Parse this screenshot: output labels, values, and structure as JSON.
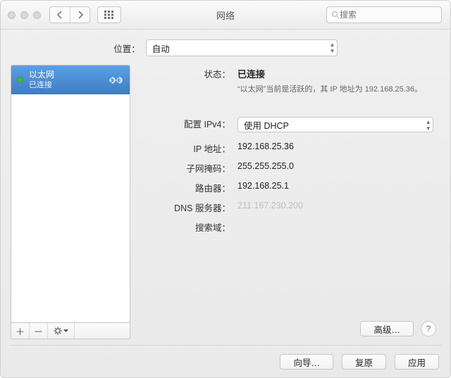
{
  "window": {
    "title": "网络"
  },
  "toolbar": {
    "search_placeholder": "搜索",
    "back_label": "‹",
    "fwd_label": "›"
  },
  "location": {
    "label": "位置：",
    "value": "自动"
  },
  "sidebar": {
    "items": [
      {
        "name": "以太网",
        "status_text": "已连接",
        "status_color": "#3fb93f"
      }
    ],
    "add_label": "＋",
    "remove_label": "－"
  },
  "detail": {
    "status": {
      "label": "状态：",
      "value": "已连接",
      "note": "“以太网”当前是活跃的，其 IP 地址为 192.168.25.36。"
    },
    "config_ipv4": {
      "label": "配置 IPv4：",
      "value": "使用 DHCP"
    },
    "ip": {
      "label": "IP 地址：",
      "value": "192.168.25.36"
    },
    "mask": {
      "label": "子网掩码：",
      "value": "255.255.255.0"
    },
    "router": {
      "label": "路由器：",
      "value": "192.168.25.1"
    },
    "dns": {
      "label": "DNS 服务器：",
      "value": "211.167.230.200"
    },
    "search_domain": {
      "label": "搜索域：",
      "value": ""
    },
    "advanced_label": "高级…",
    "help_label": "?"
  },
  "bottom": {
    "assist": "向导…",
    "revert": "复原",
    "apply": "应用"
  }
}
